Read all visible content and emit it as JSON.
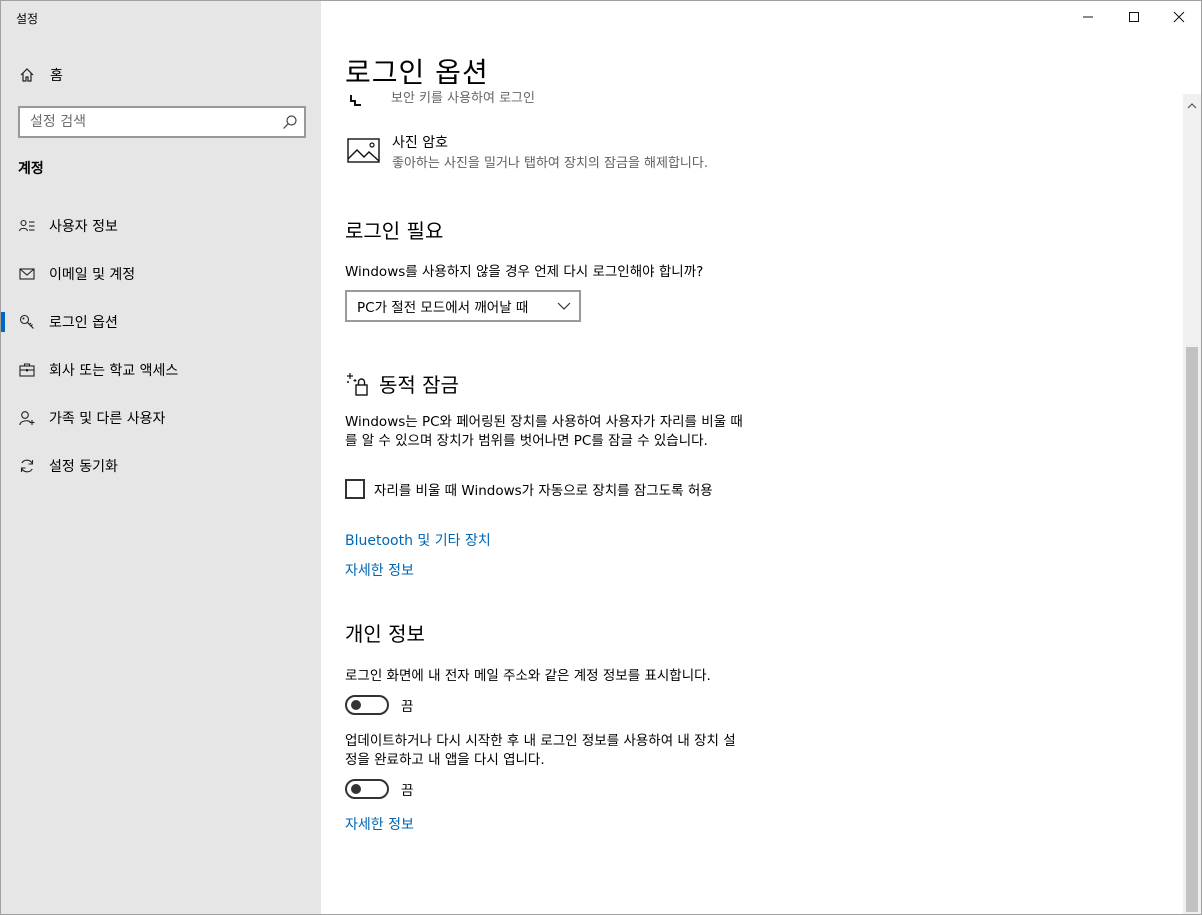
{
  "window": {
    "app_title": "설정"
  },
  "sidebar": {
    "home_label": "홈",
    "search_placeholder": "설정 검색",
    "section_label": "계정",
    "items": [
      {
        "label": "사용자 정보",
        "icon": "user-info-icon"
      },
      {
        "label": "이메일 및 계정",
        "icon": "mail-icon"
      },
      {
        "label": "로그인 옵션",
        "icon": "key-icon",
        "active": true
      },
      {
        "label": "회사 또는 학교 액세스",
        "icon": "briefcase-icon"
      },
      {
        "label": "가족 및 다른 사용자",
        "icon": "add-user-icon"
      },
      {
        "label": "설정 동기화",
        "icon": "sync-icon"
      }
    ]
  },
  "main": {
    "title": "로그인 옵션",
    "clipped_row_text": "보안 키를 사용하여 로그인",
    "picture_password": {
      "title": "사진 암호",
      "description": "좋아하는 사진을 밀거나 탭하여 장치의 잠금을 해제합니다."
    },
    "require_signin": {
      "heading": "로그인 필요",
      "question": "Windows를 사용하지 않을 경우 언제 다시 로그인해야 합니까?",
      "dropdown_value": "PC가 절전 모드에서 깨어날 때"
    },
    "dynamic_lock": {
      "heading": "동적 잠금",
      "description_line1": "Windows는 PC와 페어링된 장치를 사용하여 사용자가 자리를 비울 때",
      "description_line2": "를 알 수 있으며 장치가 범위를 벗어나면 PC를 잠글 수 있습니다.",
      "checkbox_label": "자리를 비울 때 Windows가 자동으로 장치를 잠그도록 허용",
      "checkbox_checked": false,
      "link_bluetooth": "Bluetooth 및 기타 장치",
      "link_more_info": "자세한 정보"
    },
    "privacy": {
      "heading": "개인 정보",
      "setting1_text": "로그인 화면에 내 전자 메일 주소와 같은 계정 정보를 표시합니다.",
      "setting1_state": "끔",
      "setting2_line1": "업데이트하거나 다시 시작한 후 내 로그인 정보를 사용하여 내 장치 설",
      "setting2_line2": "정을 완료하고 내 앱을 다시 엽니다.",
      "setting2_state": "끔",
      "link_more_info": "자세한 정보"
    }
  },
  "colors": {
    "link": "#0066b4",
    "accent": "#0067c0",
    "sidebar_bg": "#e6e6e6"
  }
}
